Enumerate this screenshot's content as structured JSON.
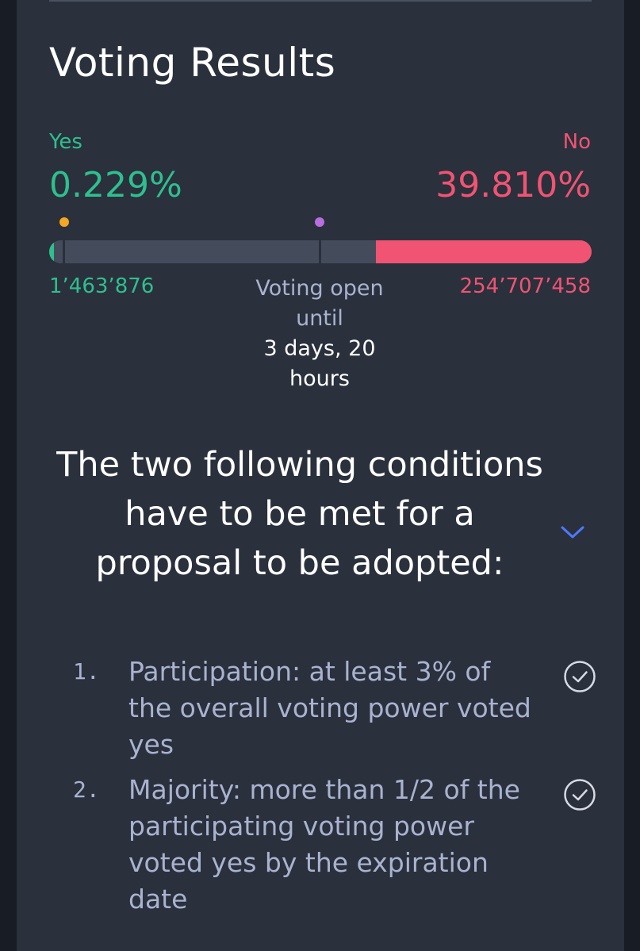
{
  "title": "Voting Results",
  "results": {
    "yes_label": "Yes",
    "no_label": "No",
    "yes_percent": "0.229%",
    "no_percent": "39.810%",
    "yes_count": "1’463’876",
    "no_count": "254’707’458",
    "yes_fraction": 0.00229,
    "no_fraction": 0.3981
  },
  "status": {
    "line1": "Voting open",
    "line2": "until",
    "line3": "3 days, 20",
    "line4": "hours"
  },
  "conditions": {
    "heading": "The two following conditions have to be met for a proposal to be adopted:",
    "items": [
      {
        "number": "1.",
        "text": "Participation: at least 3% of the overall voting power voted yes"
      },
      {
        "number": "2.",
        "text": "Majority: more than 1/2 of the participating voting power voted yes by the expiration date"
      }
    ]
  },
  "colors": {
    "yes": "#2fbf8f",
    "no": "#f05472",
    "marker_participation": "#f5a623",
    "marker_majority": "#b86ee0",
    "accent": "#4f78ff"
  },
  "icons": {
    "expand": "chevron-down-icon",
    "condition_status": "check-circle-icon"
  }
}
